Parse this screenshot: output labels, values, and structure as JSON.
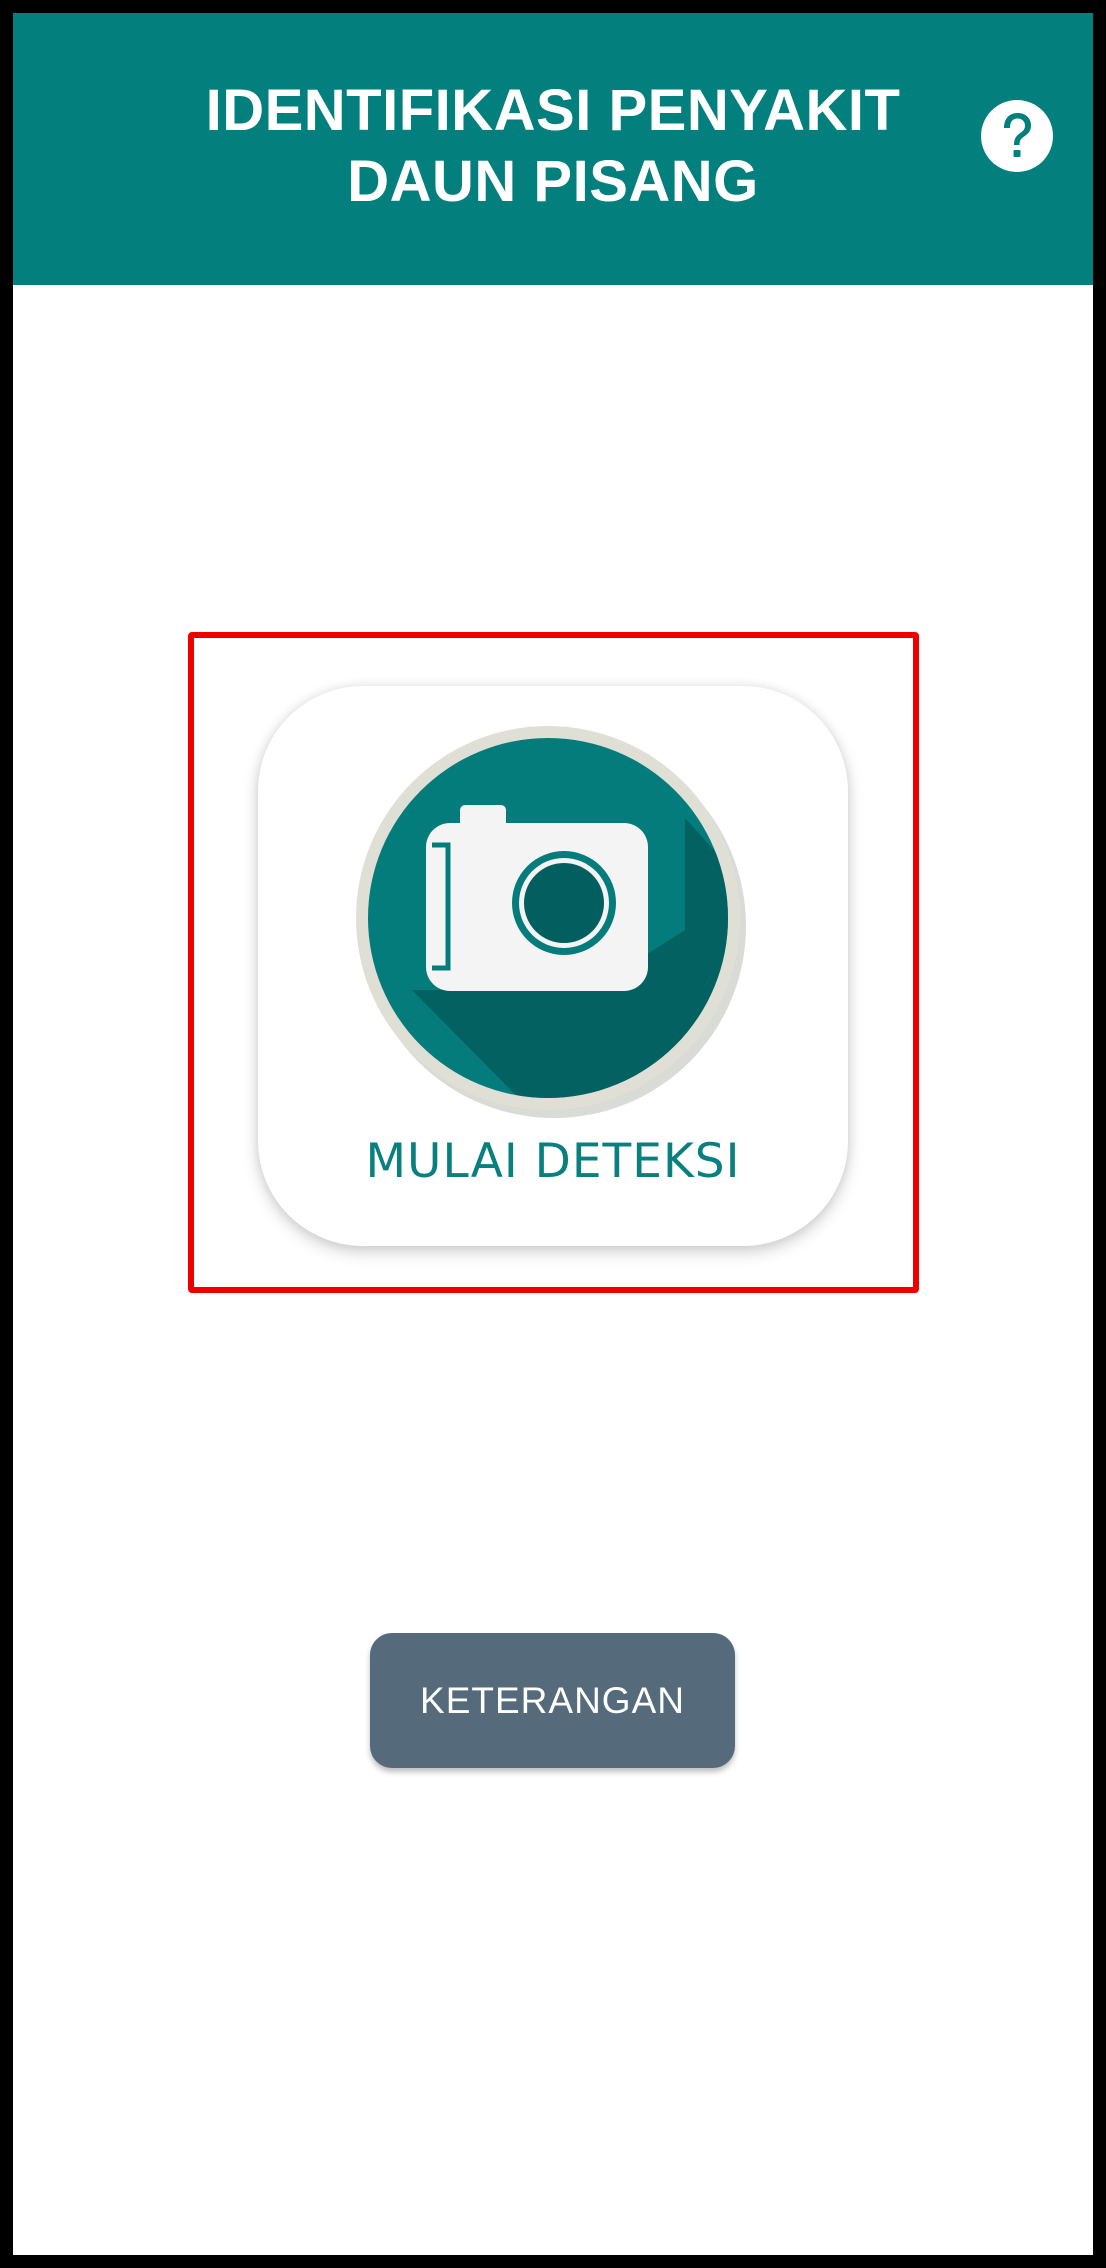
{
  "header": {
    "title_line1": "IDENTIFIKASI PENYAKIT",
    "title_line2": "DAUN PISANG",
    "help_icon": "question-circle-icon",
    "background_color": "#037f7e"
  },
  "main": {
    "start_detection": {
      "label": "MULAI DETEKSI",
      "icon": "camera-icon",
      "accent_color": "#097f80"
    },
    "info_button": {
      "label": "KETERANGAN",
      "color": "#556b7b"
    }
  },
  "highlight": {
    "color": "#ee0000"
  }
}
